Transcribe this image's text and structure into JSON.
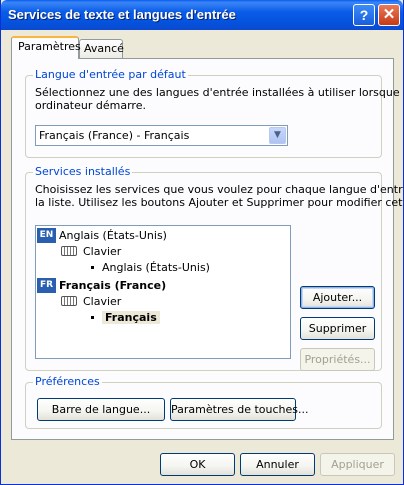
{
  "window": {
    "title": "Services de texte et langues d'entrée",
    "help_glyph": "?",
    "close_glyph": "✕"
  },
  "tabs": [
    {
      "label": "Paramètres",
      "active": true
    },
    {
      "label": "Avancé",
      "active": false
    }
  ],
  "default_language": {
    "group_label": "Langue d'entrée par défaut",
    "description_line1": "Sélectionnez une des langues d'entrée installées à utiliser lorsque votre",
    "description_line2": "ordinateur démarre.",
    "selected_value": "Français (France) - Français",
    "arrow_glyph": "▼"
  },
  "installed_services": {
    "group_label": "Services installés",
    "description_line1": "Choisissez les services que vous voulez pour chaque langue d'entrée de",
    "description_line2": "la liste. Utilisez les boutons Ajouter et Supprimer pour modifier cette liste.",
    "tree": [
      {
        "badge": "EN",
        "label": "Anglais (États-Unis)"
      },
      {
        "label": "Clavier"
      },
      {
        "label": "Anglais (États-Unis)"
      },
      {
        "badge": "FR",
        "label": "Français (France)"
      },
      {
        "label": "Clavier"
      },
      {
        "label": "Français"
      }
    ],
    "buttons": {
      "add": "Ajouter...",
      "remove": "Supprimer",
      "properties": "Propriétés..."
    }
  },
  "preferences": {
    "group_label": "Préférences",
    "language_bar": "Barre de langue...",
    "key_settings": "Paramètres de touches..."
  },
  "footer": {
    "ok": "OK",
    "cancel": "Annuler",
    "apply": "Appliquer"
  },
  "colors": {
    "titlebar": "#0a5ce8",
    "group_label": "#0046d5",
    "dialog_bg": "#ece9d8",
    "lang_badge": "#2a5fb0"
  }
}
